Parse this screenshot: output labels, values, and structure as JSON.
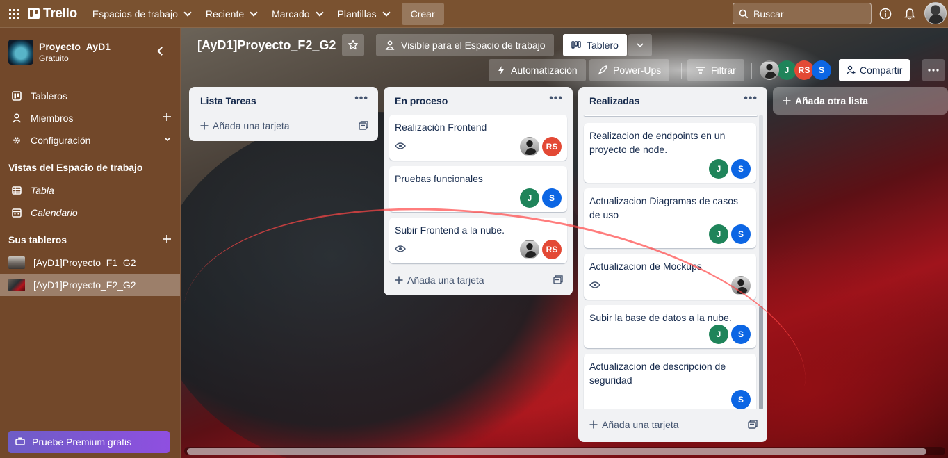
{
  "topnav": {
    "logo": "Trello",
    "menus": [
      "Espacios de trabajo",
      "Reciente",
      "Marcado",
      "Plantillas"
    ],
    "create": "Crear",
    "search_placeholder": "Buscar"
  },
  "sidebar": {
    "workspace_name": "Proyecto_AyD1",
    "workspace_plan": "Gratuito",
    "items": [
      {
        "label": "Tableros",
        "icon": "board-icon"
      },
      {
        "label": "Miembros",
        "icon": "person-icon"
      },
      {
        "label": "Configuración",
        "icon": "gear-icon"
      }
    ],
    "views_heading": "Vistas del Espacio de trabajo",
    "views": [
      {
        "label": "Tabla",
        "icon": "table-icon"
      },
      {
        "label": "Calendario",
        "icon": "calendar-icon"
      }
    ],
    "boards_heading": "Sus tableros",
    "boards": [
      {
        "label": "[AyD1]Proyecto_F1_G2",
        "active": false
      },
      {
        "label": "[AyD1]Proyecto_F2_G2",
        "active": true
      }
    ],
    "premium": "Pruebe Premium gratis"
  },
  "board": {
    "title": "[AyD1]Proyecto_F2_G2",
    "visibility": "Visible para el Espacio de trabajo",
    "view": "Tablero",
    "automation": "Automatización",
    "powerups": "Power-Ups",
    "filter": "Filtrar",
    "share": "Compartir",
    "members": [
      "J",
      "RS",
      "S"
    ],
    "add_list": "Añada otra lista",
    "add_card": "Añada una tarjeta"
  },
  "lists": [
    {
      "title": "Lista Tareas",
      "cards": []
    },
    {
      "title": "En proceso",
      "cards": [
        {
          "title": "Realización Frontend",
          "watch": true,
          "members": [
            "photo",
            "RS"
          ]
        },
        {
          "title": "Pruebas funcionales",
          "watch": false,
          "members": [
            "J",
            "S"
          ]
        },
        {
          "title": "Subir Frontend a la nube.",
          "watch": true,
          "members": [
            "photo",
            "RS"
          ]
        }
      ]
    },
    {
      "title": "Realizadas",
      "cards": [
        {
          "title": "Realizacion de endpoints en un proyecto de node.",
          "watch": false,
          "members": [
            "J",
            "S"
          ]
        },
        {
          "title": "Actualizacion Diagramas de casos de uso",
          "watch": false,
          "members": [
            "J",
            "S"
          ]
        },
        {
          "title": "Actualizacion de Mockups",
          "watch": true,
          "members": [
            "photo"
          ]
        },
        {
          "title": "Subir la base de datos a la nube.",
          "watch": false,
          "members": [
            "J",
            "S"
          ]
        },
        {
          "title": "Actualizacion de descripcion de seguridad",
          "watch": false,
          "members": [
            "S"
          ]
        }
      ]
    }
  ],
  "colors": {
    "nav": "#7a5230",
    "sidebar": "#72482a",
    "member_j": "#1f845a",
    "member_rs": "#e34935",
    "member_s": "#0c66e4",
    "premium": "#8f4fe0"
  }
}
